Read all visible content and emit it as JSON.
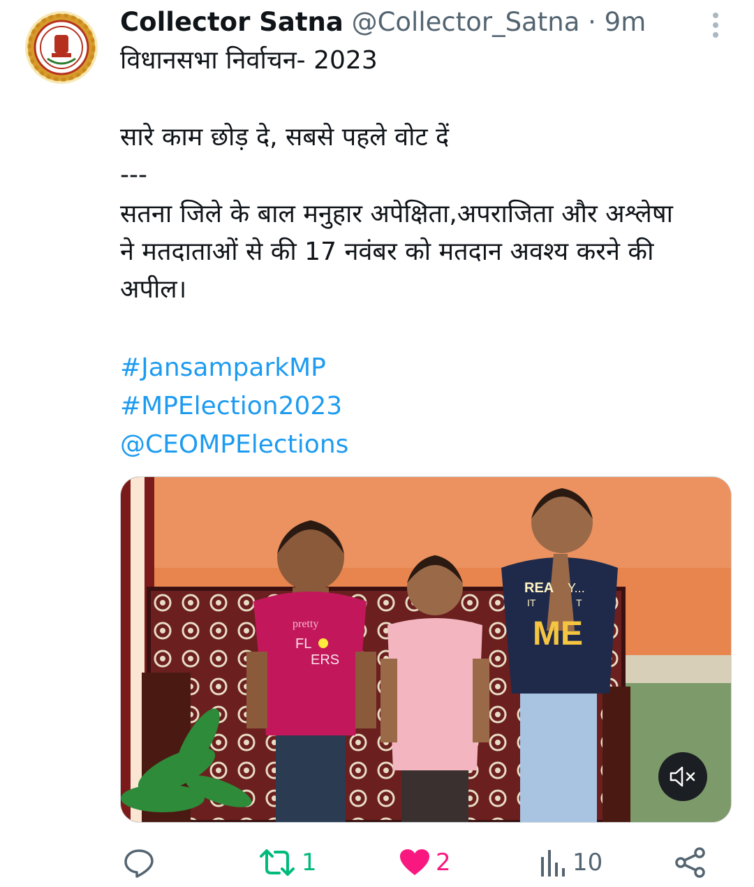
{
  "tweet": {
    "author_name": "Collector Satna",
    "handle": "@Collector_Satna",
    "separator": "·",
    "time_ago": "9m",
    "lines": [
      "विधानसभा निर्वाचन- 2023",
      "सारे काम छोड़ दे, सबसे पहले वोट दें",
      "---",
      "सतना जिले के बाल मनुहार अपेक्षिता,अपराजिता और अश्लेषा",
      "ने मतदाताओं से की 17 नवंबर को मतदान अवश्य करने की",
      "अपील।"
    ],
    "hashtags": [
      "#JansamparkMP",
      "#MPElection2023"
    ],
    "mention": "@CEOMPElections"
  },
  "media": {
    "type": "video",
    "muted": true,
    "shirt_texts": [
      "pretty",
      "FL",
      "ERS",
      "REA",
      "Y...",
      "IT",
      "T",
      "ME"
    ]
  },
  "actions": {
    "reply_count": "",
    "retweet_count": "1",
    "like_count": "2",
    "views_count": "10"
  },
  "colors": {
    "link": "#1d9bf0",
    "retweet_active": "#00ba7c",
    "like_active": "#f91880",
    "muted_text": "#536471",
    "icon_gray": "#536471"
  },
  "icons": [
    "more-vertical-icon",
    "mute-icon",
    "reply-icon",
    "retweet-icon",
    "heart-icon",
    "views-icon",
    "share-icon"
  ]
}
